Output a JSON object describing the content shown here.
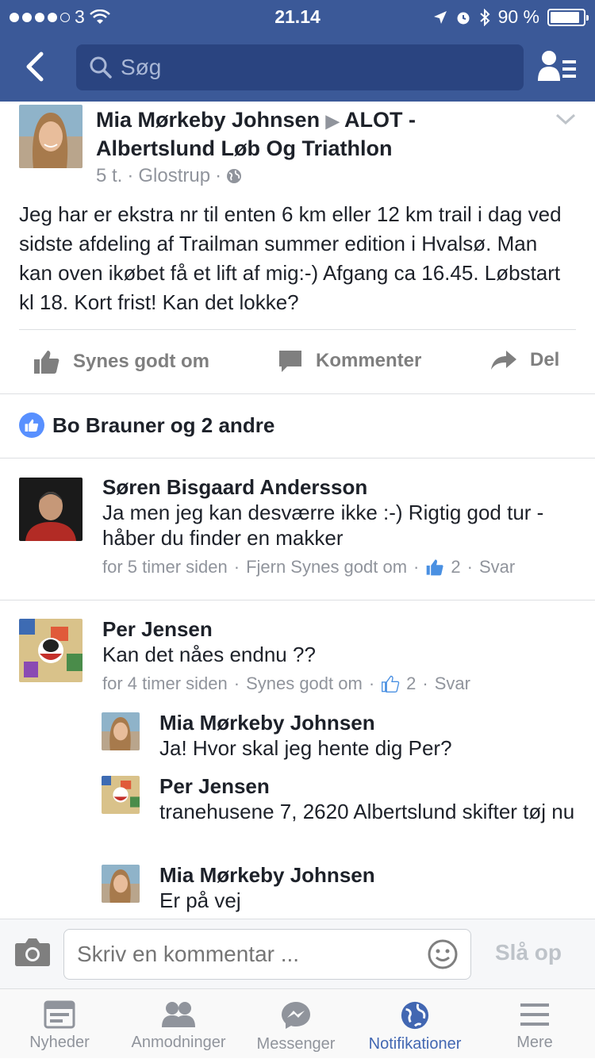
{
  "status_bar": {
    "carrier": "3",
    "time": "21.14",
    "battery": "90 %",
    "battery_level": 0.9
  },
  "nav": {
    "search_placeholder": "Søg"
  },
  "post": {
    "author": "Mia Mørkeby Johnsen",
    "target": "ALOT - Albertslund Løb Og Triathlon",
    "time": "5 t.",
    "location": "Glostrup",
    "body": "Jeg har er ekstra nr til enten 6 km eller 12 km trail i dag ved sidste afdeling af Trailman summer edition i Hvalsø. Man kan oven ikøbet få et lift af mig:-) Afgang ca 16.45. Løbstart kl 18. Kort frist! Kan det lokke?"
  },
  "actions": {
    "like": "Synes godt om",
    "comment": "Kommenter",
    "share": "Del"
  },
  "likes_summary": "Bo Brauner og 2 andre",
  "comments": [
    {
      "name": "Søren Bisgaard Andersson",
      "text": "Ja men jeg kan desværre ikke :-) Rigtig god tur - håber du finder en makker",
      "time": "for 5 timer siden",
      "like_action": "Fjern Synes godt om",
      "like_count": "2",
      "reply": "Svar"
    },
    {
      "name": "Per Jensen",
      "text": "Kan det nåes endnu ??",
      "time": "for 4 timer siden",
      "like_action": "Synes godt om",
      "like_count": "2",
      "reply": "Svar",
      "replies": [
        {
          "name": "Mia Mørkeby Johnsen",
          "text": "Ja! Hvor skal jeg hente dig Per?"
        },
        {
          "name": "Per Jensen",
          "text": "tranehusene 7, 2620 Albertslund skifter tøj nu"
        },
        {
          "name": "Mia Mørkeby Johnsen",
          "text": "Er på vej"
        }
      ]
    }
  ],
  "comment_bar": {
    "placeholder": "Skriv en kommentar ...",
    "post_button": "Slå op"
  },
  "tabs": [
    {
      "label": "Nyheder",
      "icon": "news-feed-icon"
    },
    {
      "label": "Anmodninger",
      "icon": "friend-requests-icon"
    },
    {
      "label": "Messenger",
      "icon": "messenger-icon"
    },
    {
      "label": "Notifikationer",
      "icon": "globe-icon",
      "active": true
    },
    {
      "label": "Mere",
      "icon": "menu-icon"
    }
  ],
  "colors": {
    "brand": "#3b5998",
    "active_tab": "#4267b2",
    "meta_text": "#90949c"
  }
}
